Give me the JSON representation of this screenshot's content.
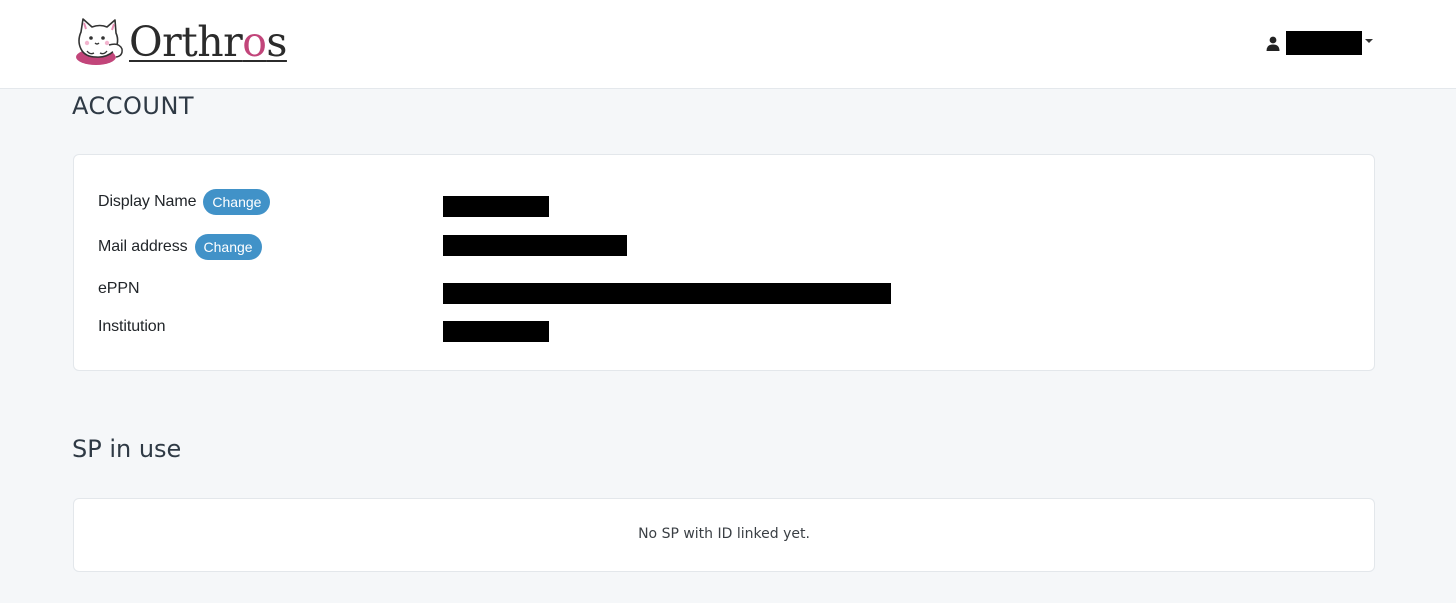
{
  "header": {
    "brand": {
      "prefix": "Orthr",
      "accent": "o",
      "suffix": "s"
    },
    "user": {
      "name": "████████",
      "icon": "user-icon"
    }
  },
  "account": {
    "title": "ACCOUNT",
    "rows": [
      {
        "label": "Display Name",
        "change_label": "Change",
        "value": "█████████"
      },
      {
        "label": "Mail address",
        "change_label": "Change",
        "value": "████████████████"
      },
      {
        "label": "ePPN",
        "value": "████████████████████████████████████████"
      },
      {
        "label": "Institution",
        "value": "█████████"
      }
    ]
  },
  "sp": {
    "title": "SP in use",
    "empty_message": "No SP with ID linked yet."
  },
  "colors": {
    "accent": "#4192c8",
    "brand_accent": "#c2457a",
    "page_bg": "#f5f7f9"
  }
}
